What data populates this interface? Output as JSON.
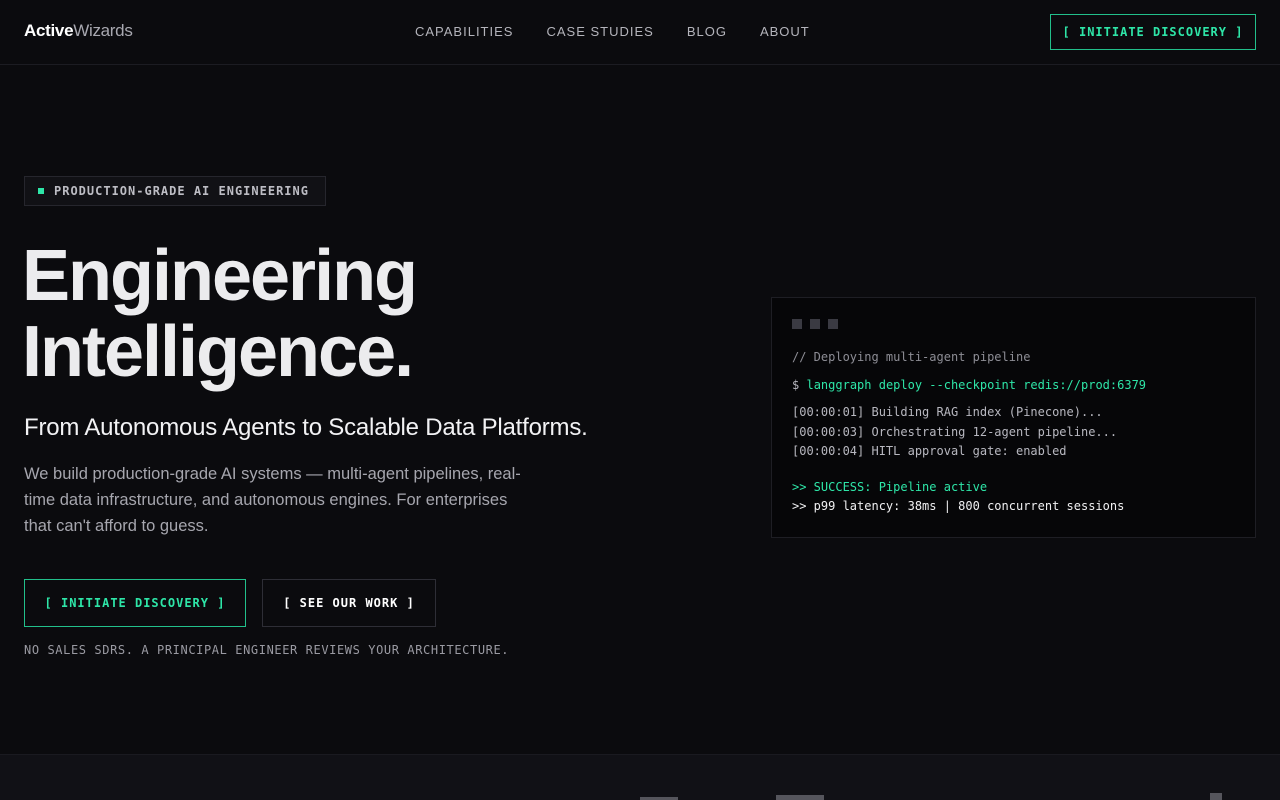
{
  "brand": {
    "part1": "Active",
    "part2": "Wizards"
  },
  "nav": {
    "links": [
      "CAPABILITIES",
      "CASE STUDIES",
      "BLOG",
      "ABOUT"
    ],
    "cta": "[ INITIATE DISCOVERY ]"
  },
  "hero": {
    "badge": "PRODUCTION-GRADE AI ENGINEERING",
    "headline_line1": "Engineering",
    "headline_line2": "Intelligence.",
    "subhead": "From Autonomous Agents to Scalable Data Platforms.",
    "description": "We build production-grade AI systems — multi-agent pipelines, real-time data infrastructure, and autonomous engines. For enterprises that can't afford to guess.",
    "cta_primary": "[ INITIATE DISCOVERY ]",
    "cta_secondary": "[ SEE OUR WORK ]",
    "note": "NO SALES SDRS. A PRINCIPAL ENGINEER REVIEWS YOUR ARCHITECTURE."
  },
  "terminal": {
    "comment": "// Deploying multi-agent pipeline",
    "prompt": "$",
    "command": "langgraph deploy --checkpoint redis://prod:6379",
    "logs": [
      "[00:00:01] Building RAG index (Pinecone)...",
      "[00:00:03] Orchestrating 12-agent pipeline...",
      "[00:00:04] HITL approval gate: enabled"
    ],
    "success": ">> SUCCESS: Pipeline active",
    "stats": ">> p99 latency: 38ms | 800 concurrent sessions"
  },
  "colors": {
    "accent": "#2ee6a8",
    "background": "#0b0b0e",
    "terminal_bg": "#060608"
  }
}
